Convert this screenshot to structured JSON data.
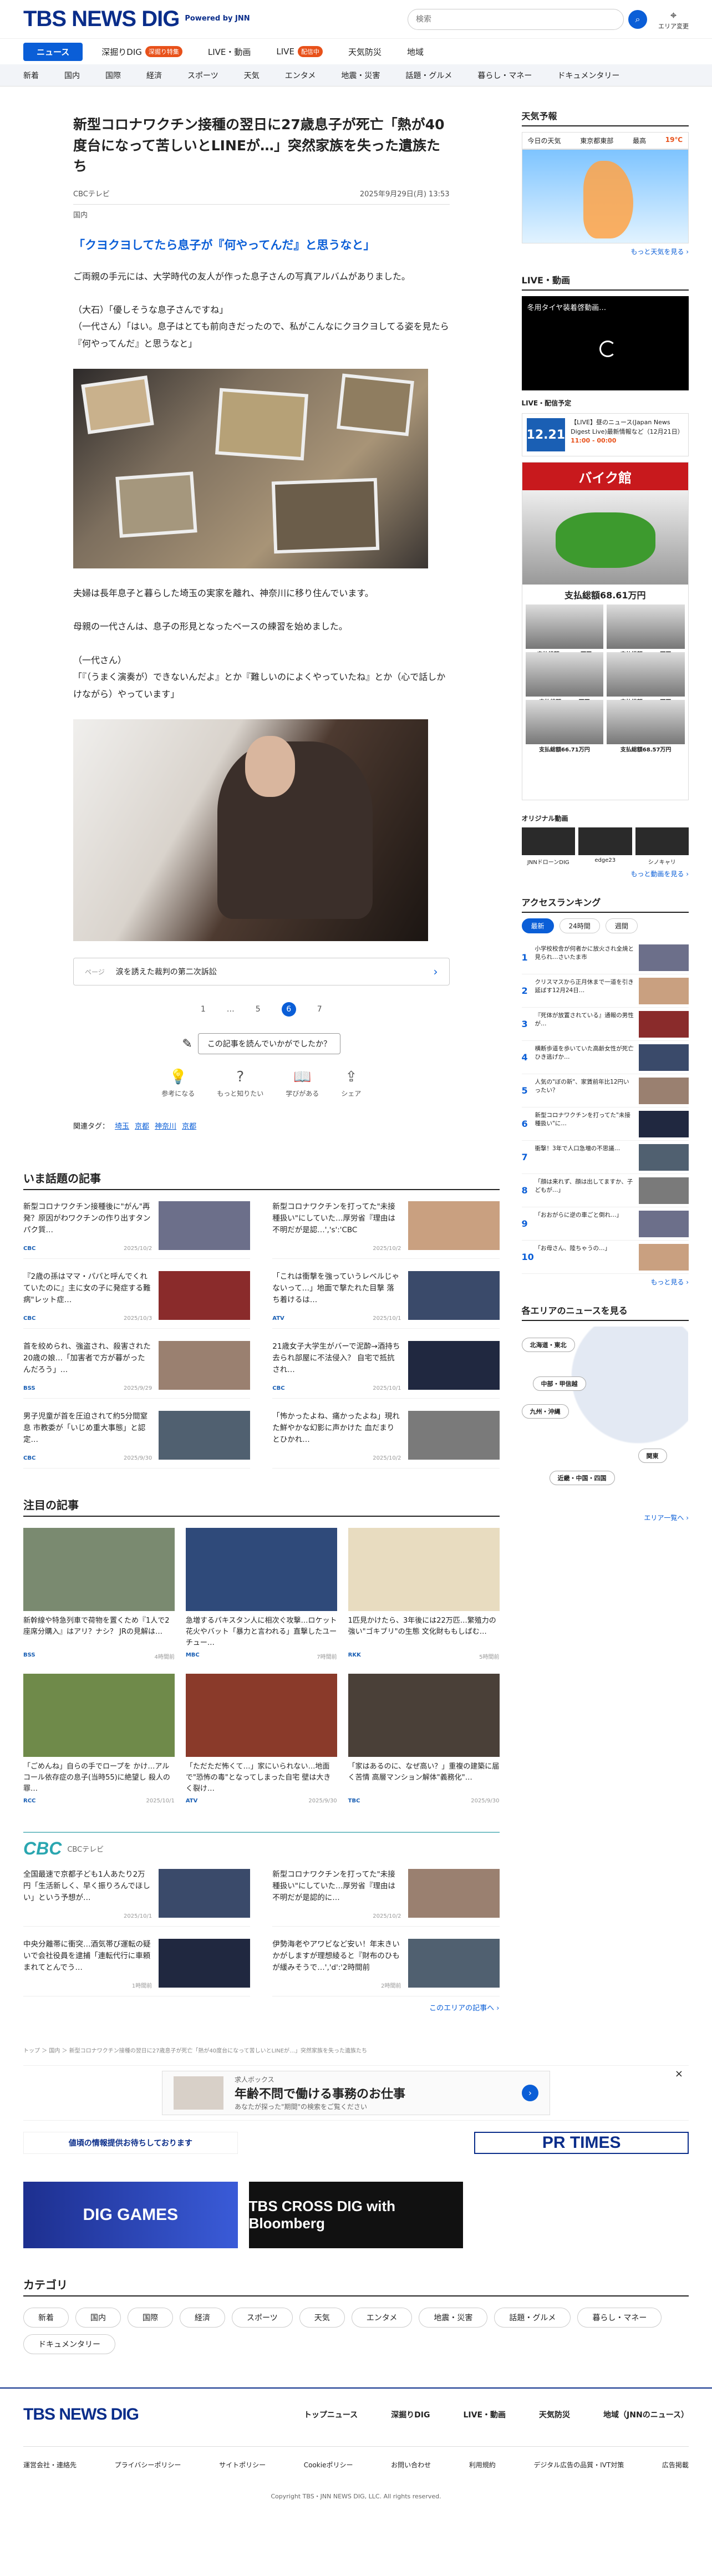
{
  "header": {
    "logo_main": "TBS NEWS DIG",
    "logo_powered": "Powered by JNN",
    "search_placeholder": "検索",
    "area_label": "エリア変更"
  },
  "nav1": {
    "items": [
      {
        "label": "ニュース"
      },
      {
        "label": "深掘りDIG",
        "badge": "深掘り特集"
      },
      {
        "label": "LIVE・動画"
      },
      {
        "label": "LIVE",
        "badge": "配信中"
      },
      {
        "label": "天気防災"
      },
      {
        "label": "地域"
      }
    ]
  },
  "nav2": {
    "items": [
      "新着",
      "国内",
      "国際",
      "経済",
      "スポーツ",
      "天気",
      "エンタメ",
      "地震・災害",
      "話題・グルメ",
      "暮らし・マネー",
      "ドキュメンタリー"
    ]
  },
  "article": {
    "title": "新型コロナワクチン接種の翌日に27歳息子が死亡「熱が40度台になって苦しいとLINEが…」突然家族を失った遺族たち",
    "source": "CBCテレビ",
    "date": "2025年9月29日(月) 13:53",
    "category": "国内",
    "subhead": "「クヨクヨしてたら息子が『何やってんだ』と思うなと」",
    "p1": "ご両親の手元には、大学時代の友人が作った息子さんの写真アルバムがありました。",
    "p2": "（大石）「優しそうな息子さんですね」\n（一代さん）「はい。息子はとても前向きだったので、私がこんなにクヨクヨしてる姿を見たら『何やってんだ』と思うなと」",
    "p3": "夫婦は長年息子と暮らした埼玉の実家を離れ、神奈川に移り住んでいます。",
    "p4": "母親の一代さんは、息子の形見となったベースの練習を始めました。",
    "p5": "（一代さん）\n「『（うまく演奏が）できないんだよ』とか『難しいのによくやっていたね』とか（心で話しかけながら）やっています」",
    "next_label": "ページ",
    "next_text": "涙を誘えた裁判の第二次訴訟",
    "pages": [
      "1",
      "…",
      "5",
      "6",
      "7"
    ],
    "feedback_q": "この記事を読んでいかがでしたか？",
    "reactions": [
      "参考になる",
      "もっと知りたい",
      "学びがある",
      "シェア"
    ],
    "tags_label": "関連タグ：",
    "tags": [
      "埼玉",
      "京都",
      "神奈川",
      "京都"
    ]
  },
  "hot": {
    "title": "いま話題の記事",
    "items": [
      {
        "t": "新型コロナワクチン接種後に\"がん\"再発？原因がわワクチンの作り出すタンパク質…",
        "s": "CBC",
        "d": "2025/10/2"
      },
      {
        "t": "新型コロナワクチンを打ってた\"未接種扱い\"にしていた…厚労省『理由は不明だが是認…','s':'CBC",
        "d": "2025/10/2"
      },
      {
        "t": "『2歳の孫はママ・パパと呼んでくれていたのに』主に女の子に発症する難病\"レット症…",
        "s": "CBC",
        "d": "2025/10/3"
      },
      {
        "t": "「これは衝撃を強っていうレベルじゃないって…」地面で撃たれた目撃 落ち着けるは…",
        "s": "ATV",
        "d": "2025/10/1"
      },
      {
        "t": "首を絞められ、強盗され、殺害された20歳の娘…「加害者で方が暮がったんだろう」…",
        "s": "BSS",
        "d": "2025/9/29"
      },
      {
        "t": "21歳女子大学生がバーで泥酔→酒持ち去られ部屋に不法侵入？ 自宅で抵抗され…",
        "s": "CBC",
        "d": "2025/10/1"
      },
      {
        "t": "男子児童が首を圧迫されて約5分間窒息 市教委が「いじめ重大事態」と認定…",
        "s": "CBC",
        "d": "2025/9/30"
      },
      {
        "t": "「怖かったよね、痛かったよね」現れた鮮やかな幻影に声かけた 血だまりとひかれ…",
        "s": "",
        "d": "2025/10/2"
      }
    ]
  },
  "attention": {
    "title": "注目の記事",
    "items": [
      {
        "t": "新幹線や特急列車で荷物を置くため『1人で2座席分購入』はアリ？ナシ？ JRの見解は…",
        "s": "BSS",
        "d": "4時間前"
      },
      {
        "t": "急増するパキスタン人に相次ぐ攻撃…ロケット花火やバット「暴力と言われる」直撃したユーチュー…",
        "s": "MBC",
        "d": "7時間前"
      },
      {
        "t": "1匹見かけたら、3年後には22万匹…繁殖力の強い\"ゴキブリ\"の生態 文化財ももしばむ…",
        "s": "RKK",
        "d": "5時間前"
      },
      {
        "t": "「ごめんね」自らの手でロープを かけ…アルコール依存症の息子(当時55)に絶望し 殺人の罪…",
        "s": "RCC",
        "d": "2025/10/1"
      },
      {
        "t": "「ただただ怖くて…」家にいられない…地面で\"恐怖の毒\"となってしまった自宅 壁は大きく裂け…",
        "s": "ATV",
        "d": "2025/9/30"
      },
      {
        "t": "「家はあるのに、なぜ高い？」重複の建築に届く苦情 高層マンション解体\"義務化\"…",
        "s": "TBC",
        "d": "2025/9/30"
      }
    ]
  },
  "cbc": {
    "logo": "CBC",
    "label": "CBCテレビ",
    "items": [
      {
        "t": "全国最速で京都子ども1人あたり2万円「生活新しく、早く振りろんでほしい」という予想が…",
        "d": "2025/10/1"
      },
      {
        "t": "新型コロナワクチンを打ってた\"未接種扱い\"にしていた…厚労省『理由は不明だが是認的に…",
        "d": "2025/10/2"
      },
      {
        "t": "中央分離帯に衝突…酒気帯び運転の疑いで会社役員を逮捕「連転代行に車頼まれてとんでう…",
        "d": "1時間前"
      },
      {
        "t": "伊勢海老やアワビなど安い！年末きいかがしますが理想綾ると『財布のひもが緩みそうで…','d':'2時間前",
        "d": "2時間前"
      }
    ],
    "more": "このエリアの記事へ ›"
  },
  "breadcrumb": "トップ ＞ 国内 ＞ 新型コロナワクチン接種の翌日に27歳息子が死亡「熱が40度台になって苦しいとLINEが…」突然家族を失った遺族たち",
  "ad": {
    "brand": "求人ボックス",
    "title": "年齢不問で働ける事務のお仕事",
    "sub": "あなたが探った\"期間\"の検索をご覧ください"
  },
  "banners": [
    "値頃の情報提供お待ちしております",
    "DIG GAMES",
    "TBS CROSS DIG with Bloomberg"
  ],
  "banner_top": [
    "",
    "",
    "PR TIMES"
  ],
  "categories": {
    "title": "カテゴリ",
    "items": [
      "新着",
      "国内",
      "国際",
      "経済",
      "スポーツ",
      "天気",
      "エンタメ",
      "地震・災害",
      "話題・グルメ",
      "暮らし・マネー",
      "ドキュメンタリー"
    ]
  },
  "side": {
    "weather": {
      "title": "天気予報",
      "today": "今日の天気",
      "place": "東京都東部",
      "max": "最高",
      "max_v": "19℃",
      "link": "もっと天気を見る ›"
    },
    "live": {
      "title": "LIVE・動画",
      "video": "冬用タイヤ装着啓動画…",
      "sched_title": "LIVE・配信予定",
      "sched_date": "12.21",
      "sched_text": "【LIVE】昼のニュース(Japan News Digest Live)最新情報など（12月21日）",
      "sched_time": "11:00 - 00:00"
    },
    "bike": {
      "banner": "バイク館",
      "main_price": "支払総額68.61万円",
      "prices": [
        "支払総額121.54万円",
        "支払総額66.67万円",
        "支払総額67.54万円",
        "支払総額99.66万円",
        "支払総額66.71万円",
        "支払総額68.57万円"
      ]
    },
    "orig": {
      "title": "オリジナル動画",
      "items": [
        "JNNドローンDIG",
        "edge23",
        "シノキャリ"
      ],
      "more": "もっと動画を見る ›"
    },
    "ranking": {
      "title": "アクセスランキング",
      "tabs": [
        "最新",
        "24時間",
        "週間"
      ],
      "items": [
        "小学校校舎が何者かに放火され全焼と見られ…さいたま市",
        "クリスマスから正月休まで一道を引き延ばす12月24日…",
        "『死体が放置されている』通報の男性が…",
        "横断歩道を歩いていた高齢女性が死亡 ひき逃げか…",
        "人気の\"ぼの新\"、家賃前年比12円いったい？",
        "新型コロナワクチンを打ってた\"未接種扱い\"に…",
        "衝撃！3年で人口急増の不思議…",
        "「顔は来れず、顔は出してますか、子どもが…」",
        "「おおがらに逆の車ごと倒れ…」",
        "「お母さん、陸ちゃうの…」"
      ],
      "more": "もっと見る ›"
    },
    "areas": {
      "title": "各エリアのニュースを見る",
      "items": [
        "北海道・東北",
        "中部・甲信越",
        "九州・沖縄",
        "関東",
        "近畿・中国・四国"
      ],
      "more": "エリア一覧へ ›"
    }
  },
  "footer": {
    "logo": "TBS NEWS DIG",
    "links": [
      "トップニュース",
      "深掘りDIG",
      "LIVE・動画",
      "天気防災",
      "地域（JNNのニュース）"
    ],
    "links2": [
      "運営会社・連絡先",
      "プライバシーポリシー",
      "サイトポリシー",
      "Cookieポリシー",
      "お問い合わせ",
      "利用規約",
      "デジタル広告の品質・IVT対策",
      "広告掲載"
    ],
    "copyright": "Copyright TBS・JNN NEWS DIG, LLC. All rights reserved."
  }
}
